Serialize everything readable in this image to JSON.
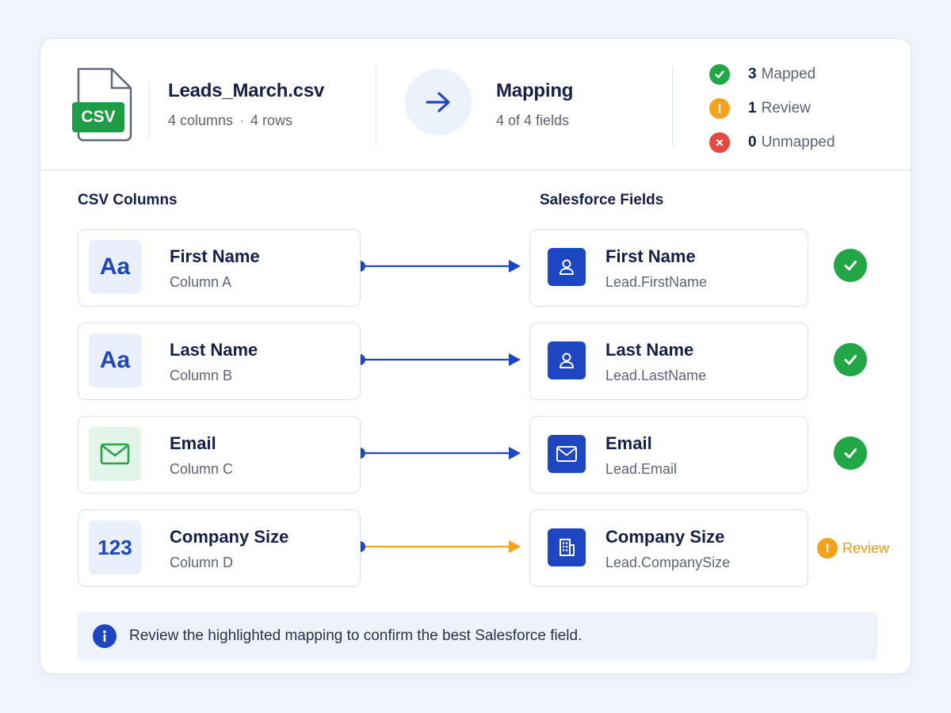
{
  "colors": {
    "accent": "#1d47c2",
    "success": "#22a746",
    "warning": "#f4a21c",
    "error": "#e8483f",
    "csv_badge": "#1f9d46"
  },
  "file": {
    "badge": "CSV",
    "icon": "csv-file-icon",
    "name": "Leads_March.csv",
    "columns": "4 columns",
    "separator": "·",
    "rows": "4 rows"
  },
  "mapping": {
    "icon": "arrow-right-icon",
    "title": "Mapping",
    "subtitle": "4 of 4 fields"
  },
  "summary": [
    {
      "count": "3",
      "label": "Mapped",
      "status": "success",
      "icon": "check-circle-icon"
    },
    {
      "count": "1",
      "label": "Review",
      "status": "warning",
      "icon": "warning-circle-icon"
    },
    {
      "count": "0",
      "label": "Unmapped",
      "status": "error",
      "icon": "x-circle-icon"
    }
  ],
  "columns": {
    "left_title": "CSV Columns",
    "right_title": "Salesforce Fields"
  },
  "rows": [
    {
      "source": {
        "name": "First Name",
        "column": "Column A",
        "icon": "text-type-icon",
        "tile_text": "Aa"
      },
      "target": {
        "name": "First Name",
        "field": "Lead.FirstName",
        "icon": "person-icon"
      },
      "status": "mapped",
      "connector_color": "#1d47c2"
    },
    {
      "source": {
        "name": "Last Name",
        "column": "Column B",
        "icon": "text-type-icon",
        "tile_text": "Aa"
      },
      "target": {
        "name": "Last Name",
        "field": "Lead.LastName",
        "icon": "person-icon"
      },
      "status": "mapped",
      "connector_color": "#1d47c2"
    },
    {
      "source": {
        "name": "Email",
        "column": "Column C",
        "icon": "envelope-icon",
        "tile_text": ""
      },
      "target": {
        "name": "Email",
        "field": "Lead.Email",
        "icon": "envelope-icon"
      },
      "status": "mapped",
      "connector_color": "#1d47c2"
    },
    {
      "source": {
        "name": "Company Size",
        "column": "Column D",
        "icon": "number-type-icon",
        "tile_text": "123"
      },
      "target": {
        "name": "Company Size",
        "field": "Lead.CompanySize",
        "icon": "building-icon"
      },
      "status": "review",
      "status_label": "Review",
      "connector_color": "#f4a21c"
    }
  ],
  "info": {
    "icon": "info-icon",
    "message": "Review the highlighted mapping to confirm the best Salesforce field."
  }
}
